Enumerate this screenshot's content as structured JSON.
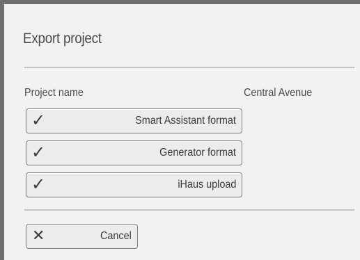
{
  "dialog": {
    "title": "Export project"
  },
  "project": {
    "name_label": "Project name",
    "name_value": "Central Avenue"
  },
  "actions": [
    {
      "label": "Smart Assistant format",
      "icon": "checkmark-icon",
      "glyph": "✓"
    },
    {
      "label": "Generator format",
      "icon": "checkmark-icon",
      "glyph": "✓"
    },
    {
      "label": "iHaus upload",
      "icon": "checkmark-icon",
      "glyph": "✓"
    }
  ],
  "cancel": {
    "label": "Cancel",
    "icon": "close-icon",
    "glyph": "✕"
  },
  "colors": {
    "frame_border": "#6f6f6f",
    "background": "#f2f2f2",
    "separator": "#c4c4c4",
    "text": "#4a4a4a"
  }
}
